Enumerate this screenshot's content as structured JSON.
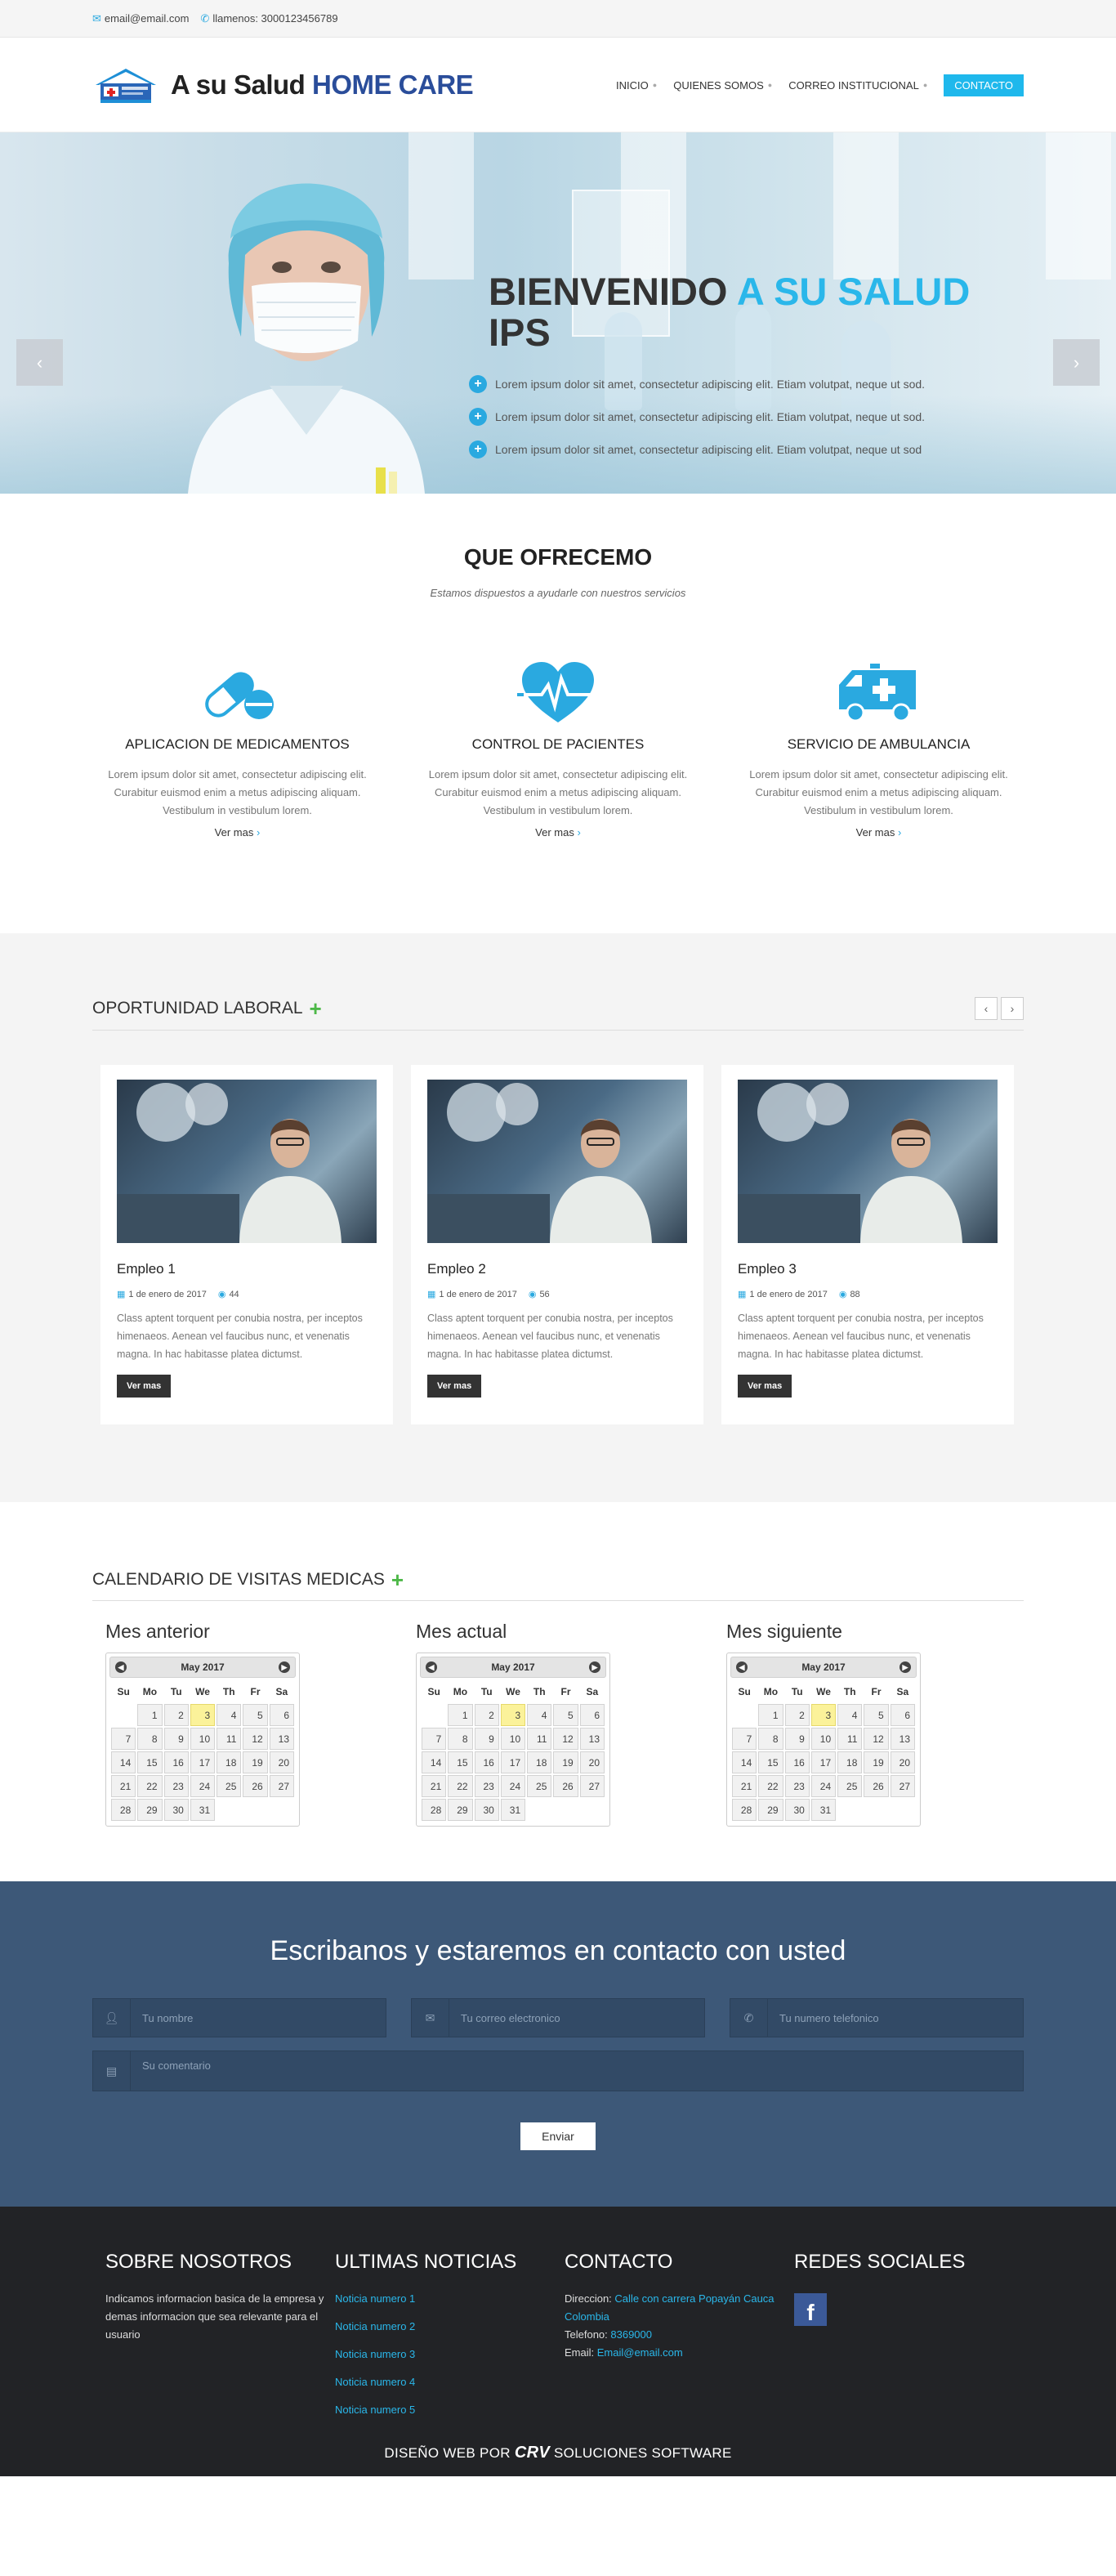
{
  "topbar": {
    "email": "email@email.com",
    "phone": "llamenos: 3000123456789"
  },
  "header": {
    "logo_plain": "A su Salud ",
    "logo_highlight": "HOME CARE",
    "nav": [
      {
        "label": "INICIO"
      },
      {
        "label": "QUIENES SOMOS"
      },
      {
        "label": "CORREO INSTITUCIONAL"
      }
    ],
    "cta": "CONTACTO"
  },
  "hero": {
    "title_plain": "BIENVENIDO ",
    "title_highlight": "A SU SALUD",
    "title_line2": "IPS",
    "bullets": [
      "Lorem ipsum dolor sit amet, consectetur adipiscing elit. Etiam volutpat, neque ut sod.",
      "Lorem ipsum dolor sit amet, consectetur adipiscing elit. Etiam volutpat, neque ut sod.",
      "Lorem ipsum dolor sit amet, consectetur adipiscing elit. Etiam volutpat, neque ut sod"
    ],
    "prev_glyph": "‹",
    "next_glyph": "›"
  },
  "offer": {
    "title": "QUE OFRECEMO",
    "subtitle": "Estamos dispuestos a ayudarle con nuestros servicios",
    "services": [
      {
        "title": "APLICACION DE MEDICAMENTOS",
        "text": "Lorem ipsum dolor sit amet, consectetur adipiscing elit. Curabitur euismod enim a metus adipiscing aliquam. Vestibulum in vestibulum lorem.",
        "more": "Ver mas",
        "icon": "pill-icon"
      },
      {
        "title": "CONTROL DE PACIENTES",
        "text": "Lorem ipsum dolor sit amet, consectetur adipiscing elit. Curabitur euismod enim a metus adipiscing aliquam. Vestibulum in vestibulum lorem.",
        "more": "Ver mas",
        "icon": "heartbeat-icon"
      },
      {
        "title": "SERVICIO DE AMBULANCIA",
        "text": "Lorem ipsum dolor sit amet, consectetur adipiscing elit. Curabitur euismod enim a metus adipiscing aliquam. Vestibulum in vestibulum lorem.",
        "more": "Ver mas",
        "icon": "ambulance-icon"
      }
    ]
  },
  "jobs": {
    "title": "OPORTUNIDAD LABORAL",
    "cards": [
      {
        "title": "Empleo 1",
        "date": "1 de enero de 2017",
        "views": "44",
        "text": "Class aptent torquent per conubia nostra, per inceptos himenaeos. Aenean vel faucibus nunc, et venenatis magna. In hac habitasse platea dictumst.",
        "button": "Ver mas"
      },
      {
        "title": "Empleo 2",
        "date": "1 de enero de 2017",
        "views": "56",
        "text": "Class aptent torquent per conubia nostra, per inceptos himenaeos. Aenean vel faucibus nunc, et venenatis magna. In hac habitasse platea dictumst.",
        "button": "Ver mas"
      },
      {
        "title": "Empleo 3",
        "date": "1 de enero de 2017",
        "views": "88",
        "text": "Class aptent torquent per conubia nostra, per inceptos himenaeos. Aenean vel faucibus nunc, et venenatis magna. In hac habitasse platea dictumst.",
        "button": "Ver mas"
      }
    ]
  },
  "calendar": {
    "title": "CALENDARIO DE VISITAS MEDICAS",
    "weekdays": [
      "Su",
      "Mo",
      "Tu",
      "We",
      "Th",
      "Fr",
      "Sa"
    ],
    "months": [
      {
        "label": "Mes anterior",
        "month": "May 2017"
      },
      {
        "label": "Mes actual",
        "month": "May 2017"
      },
      {
        "label": "Mes siguiente",
        "month": "May 2017"
      }
    ],
    "start_weekday": 1,
    "days_in_month": 31,
    "highlighted_day": 3
  },
  "contact": {
    "title": "Escribanos y estaremos en contacto con usted",
    "name_placeholder": "Tu nombre",
    "email_placeholder": "Tu correo electronico",
    "phone_placeholder": "Tu numero telefonico",
    "comment_placeholder": "Su comentario",
    "send": "Enviar"
  },
  "footer": {
    "about_title": "SOBRE NOSOTROS",
    "about_text": "Indicamos informacion basica de la empresa y demas informacion que sea relevante para el usuario",
    "news_title": "ULTIMAS NOTICIAS",
    "news": [
      "Noticia numero 1",
      "Noticia numero 2",
      "Noticia numero 3",
      "Noticia numero 4",
      "Noticia numero 5"
    ],
    "contact_title": "CONTACTO",
    "address_label": "Direccion: ",
    "address": "Calle con carrera Popayán Cauca Colombia",
    "phone_label": "Telefono: ",
    "phone": "8369000",
    "email_label": "Email: ",
    "email": "Email@email.com",
    "social_title": "REDES SOCIALES",
    "credit_prefix": "DISEÑO WEB POR ",
    "credit_brand": "CRV",
    "credit_suffix": " SOLUCIONES SOFTWARE"
  }
}
